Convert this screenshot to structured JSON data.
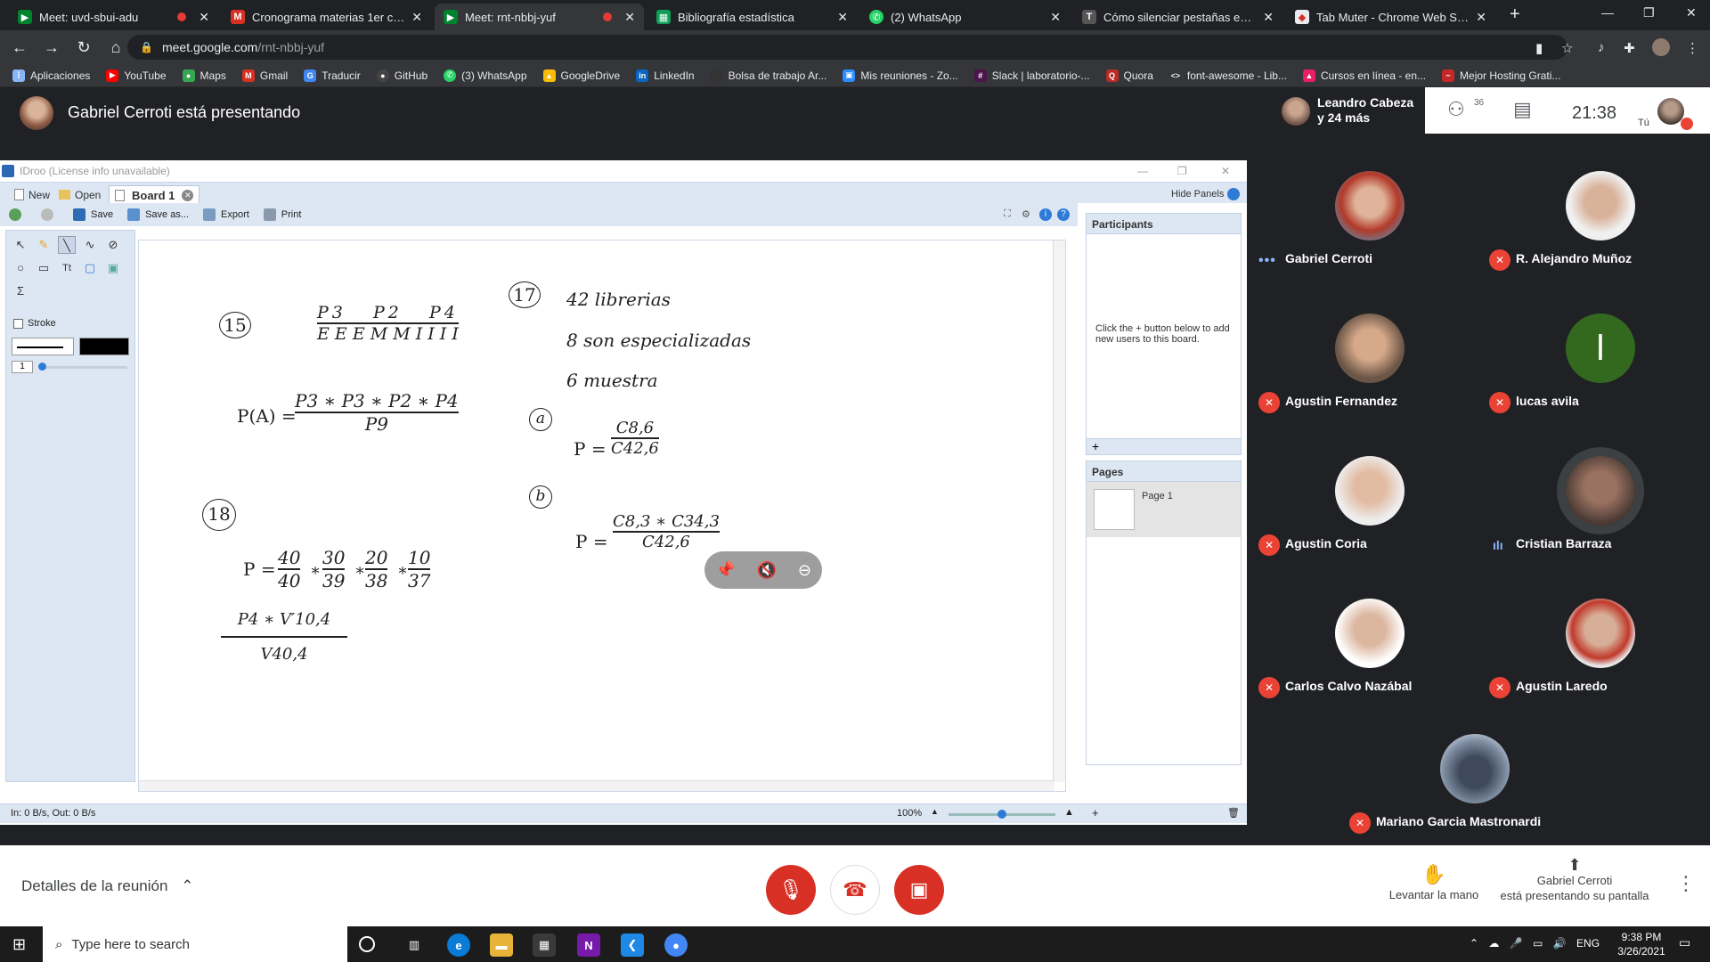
{
  "browser": {
    "tabs": [
      {
        "title": "Meet: uvd-sbui-adu",
        "recording": true,
        "active": false
      },
      {
        "title": "Cronograma materias 1er cuat 2021",
        "recording": false,
        "active": false
      },
      {
        "title": "Meet: rnt-nbbj-yuf",
        "recording": true,
        "active": true
      },
      {
        "title": "Bibliografía estadística",
        "recording": false,
        "active": false
      },
      {
        "title": "(2) WhatsApp",
        "recording": false,
        "active": false
      },
      {
        "title": "Cómo silenciar pestañas en Chrome",
        "recording": false,
        "active": false
      },
      {
        "title": "Tab Muter - Chrome Web Store",
        "recording": false,
        "active": false
      }
    ],
    "url_host": "meet.google.com",
    "url_path": "/rnt-nbbj-yuf",
    "bookmarks": [
      "Aplicaciones",
      "YouTube",
      "Maps",
      "Gmail",
      "Traducir",
      "GitHub",
      "(3) WhatsApp",
      "GoogleDrive",
      "LinkedIn",
      "Bolsa de trabajo Ar...",
      "Mis reuniones - Zo...",
      "Slack | laboratorio-...",
      "Quora",
      "font-awesome - Lib...",
      "Cursos en línea - en...",
      "Mejor Hosting Grati..."
    ]
  },
  "meet": {
    "presenting_banner": "Gabriel Cerroti está presentando",
    "header_people": "Leandro Cabeza",
    "header_people_more": "y 24 más",
    "participant_count": "36",
    "time": "21:38",
    "me_label": "Tú",
    "participants": [
      {
        "name": "Gabriel Cerroti",
        "status": "speaking"
      },
      {
        "name": "R. Alejandro Muñoz",
        "status": "muted"
      },
      {
        "name": "Agustin Fernandez",
        "status": "muted"
      },
      {
        "name": "lucas avila",
        "status": "muted",
        "initial": "l"
      },
      {
        "name": "Agustin Coria",
        "status": "muted"
      },
      {
        "name": "Cristian Barraza",
        "status": "active"
      },
      {
        "name": "Carlos Calvo Nazábal",
        "status": "muted"
      },
      {
        "name": "Agustin Laredo",
        "status": "muted"
      },
      {
        "name": "Mariano Garcia Mastronardi",
        "status": "muted"
      }
    ],
    "details_label": "Detalles de la reunión",
    "raise_hand": "Levantar la mano",
    "presenting_line1": "Gabriel Cerroti",
    "presenting_line2": "está presentando su pantalla"
  },
  "idroo": {
    "window_title": "IDroo (License info unavailable)",
    "tab_new": "New",
    "tab_open": "Open",
    "tab_board": "Board 1",
    "hide_panels": "Hide Panels",
    "toolbar": {
      "save": "Save",
      "save_as": "Save as...",
      "export": "Export",
      "print": "Print"
    },
    "stroke_label": "Stroke",
    "stroke_width": "1",
    "participants_header": "Participants",
    "participants_hint": "Click the + button below to add new users to this board.",
    "pages_header": "Pages",
    "page1": "Page 1",
    "status": "In: 0 B/s, Out: 0 B/s",
    "zoom": "100%"
  },
  "board": {
    "p15": "15",
    "p17": "17",
    "p18": "18",
    "perm_nums": [
      "P3",
      "P2",
      "P4"
    ],
    "perm_den": "E E E M M I I I I",
    "pa_left": "P(A) =",
    "pa_num": "P3 ∗ P3 ∗ P2 ∗ P4",
    "pa_den": "P9",
    "l17_1": "42 librerias",
    "l17_2": "8 son especializadas",
    "l17_3": "6 muestra",
    "a_label": "a",
    "b_label": "b",
    "pa17": "P =",
    "pa17_num": "C8,6",
    "pa17_den": "C42,6",
    "pb17": "P =",
    "pb17_num": "C8,3 ∗ C34,3",
    "pb17_den": "C42,6",
    "p18_left": "P =",
    "f18": [
      {
        "n": "40",
        "d": "40"
      },
      {
        "n": "30",
        "d": "39"
      },
      {
        "n": "20",
        "d": "38"
      },
      {
        "n": "10",
        "d": "37"
      }
    ],
    "v_num": "P4 ∗ V′10,4",
    "v_den": "V40,4"
  },
  "taskbar": {
    "search_placeholder": "Type here to search",
    "lang": "ENG",
    "clock_time": "9:38 PM",
    "clock_date": "3/26/2021"
  }
}
